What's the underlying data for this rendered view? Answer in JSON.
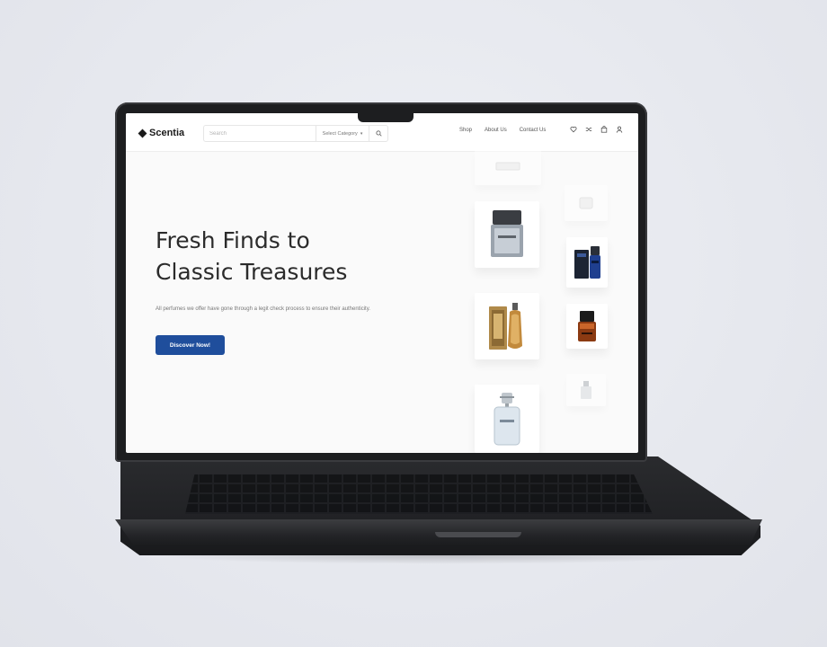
{
  "app": {
    "logo_text": "Scentia"
  },
  "header": {
    "search_placeholder": "Search",
    "category_select": "Select Category",
    "nav_links": [
      "Shop",
      "About Us",
      "Contact Us"
    ],
    "icons": [
      "heart-icon",
      "shuffle-icon",
      "cart-icon",
      "user-icon"
    ]
  },
  "hero": {
    "title_line1": "Fresh Finds to",
    "title_line2": "Classic Treasures",
    "description": "All perfumes we offer have gone through a legit check process to ensure their authenticity.",
    "cta_label": "Discover Now!"
  },
  "products": [
    "silver-square-bottle",
    "blue-black-bottle",
    "gold-torso-bottle",
    "amber-black-bottle",
    "clear-tall-bottle",
    "small-silver-bottle"
  ],
  "colors": {
    "accent": "#1f4e9c",
    "text_dark": "#2b2b2b",
    "laptop": "#1d1e20",
    "background": "#e6e8ee"
  }
}
